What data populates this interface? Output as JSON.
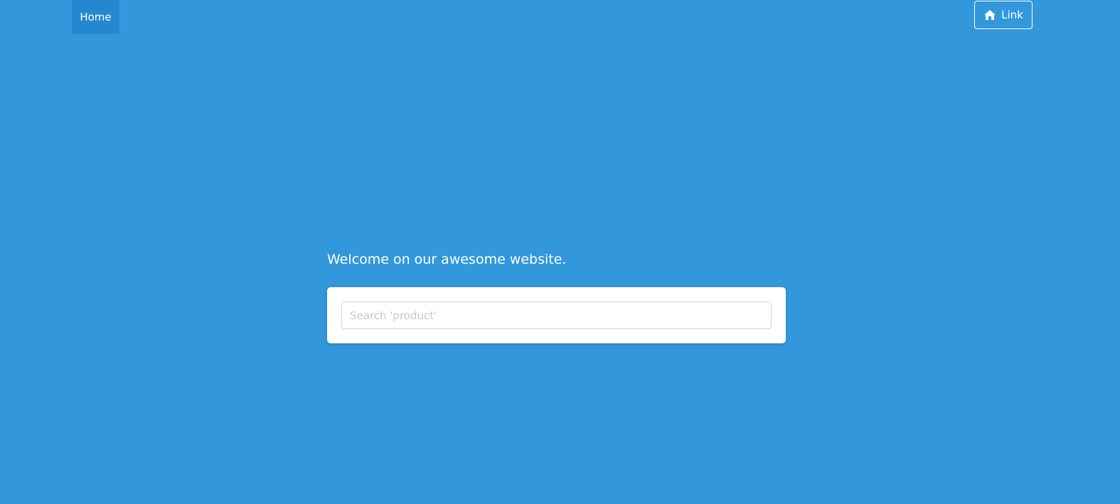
{
  "nav": {
    "home_label": "Home",
    "link_label": "Link",
    "link_icon": "home-icon"
  },
  "hero": {
    "welcome_text": "Welcome on our awesome website."
  },
  "search": {
    "placeholder": "Search 'product'",
    "value": ""
  },
  "colors": {
    "background": "#3297db",
    "home_active": "#2488d0",
    "card": "#ffffff"
  }
}
